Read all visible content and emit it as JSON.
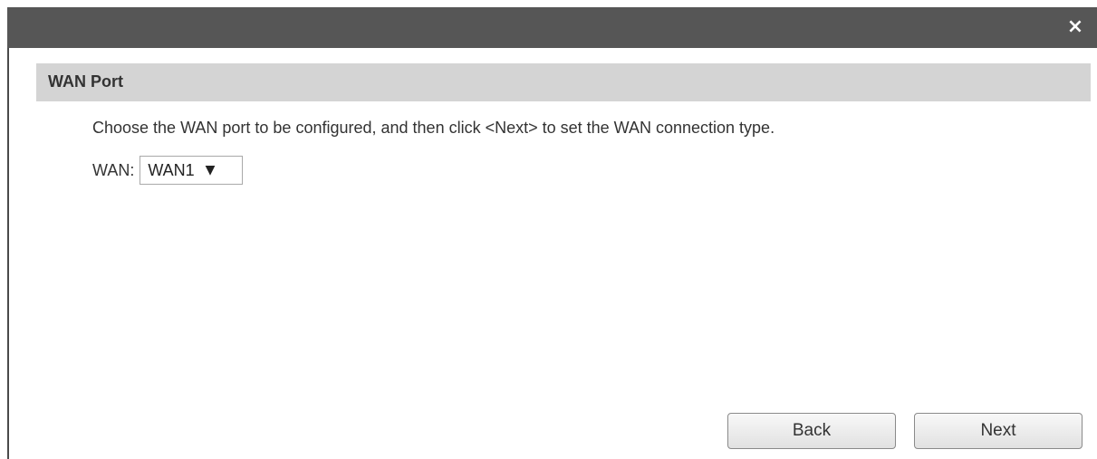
{
  "dialog": {
    "close_icon": "×"
  },
  "section": {
    "title": "WAN Port"
  },
  "instruction": "Choose the WAN port to be configured, and then click <Next> to set the WAN connection type.",
  "wan": {
    "label": "WAN:",
    "selected": "WAN1",
    "arrow": "▼"
  },
  "buttons": {
    "back": "Back",
    "next": "Next"
  }
}
